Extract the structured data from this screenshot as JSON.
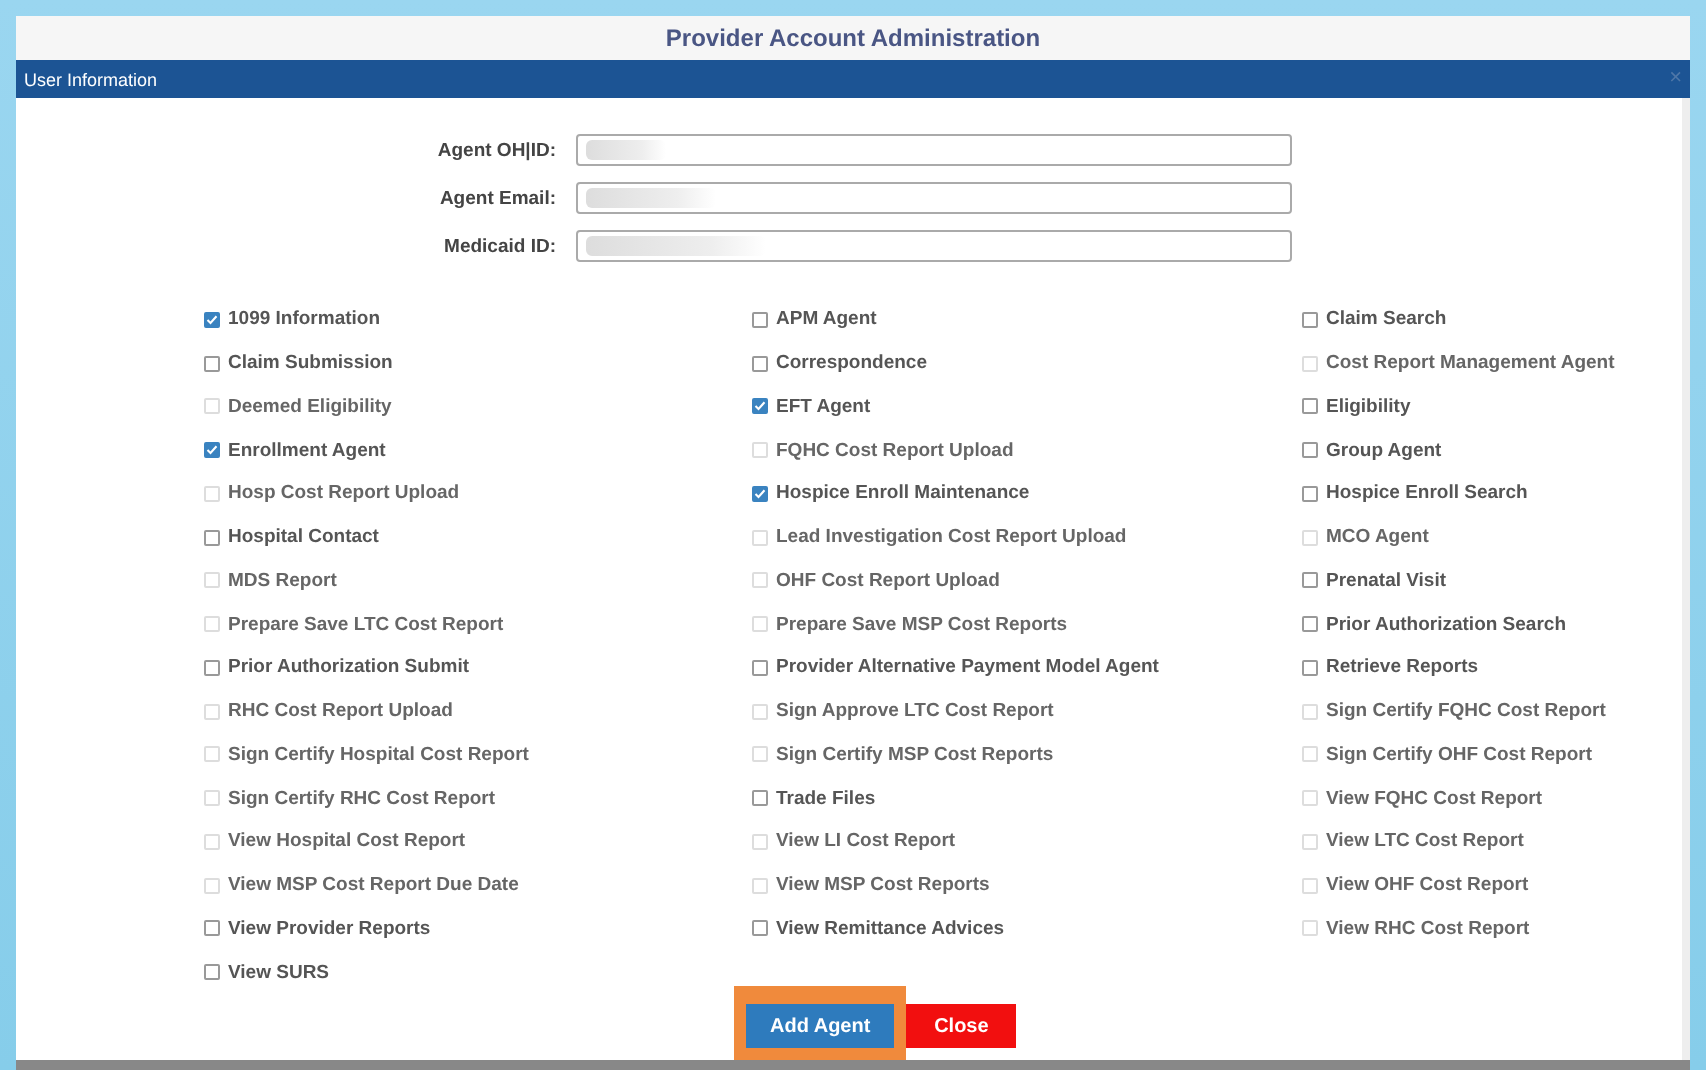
{
  "window": {
    "title": "Provider Account Administration"
  },
  "dialog": {
    "title": "User Information",
    "close": "×"
  },
  "fields": [
    {
      "label": "Agent OH|ID:"
    },
    {
      "label": "Agent Email:"
    },
    {
      "label": "Medicaid ID:"
    }
  ],
  "permission_columns": [
    [
      {
        "label": "1099 Information",
        "checked": true,
        "disabled": false
      },
      {
        "label": "Claim Submission",
        "checked": false,
        "disabled": false
      },
      {
        "label": "Deemed Eligibility",
        "checked": false,
        "disabled": true
      },
      {
        "label": "Enrollment Agent",
        "checked": true,
        "disabled": false
      },
      {
        "label": "Hosp Cost Report Upload",
        "checked": false,
        "disabled": true
      },
      {
        "label": "Hospital Contact",
        "checked": false,
        "disabled": false
      },
      {
        "label": "MDS Report",
        "checked": false,
        "disabled": true
      },
      {
        "label": "Prepare Save LTC Cost Report",
        "checked": false,
        "disabled": true
      },
      {
        "label": "Prior Authorization Submit",
        "checked": false,
        "disabled": false
      },
      {
        "label": "RHC Cost Report Upload",
        "checked": false,
        "disabled": true
      },
      {
        "label": "Sign Certify Hospital Cost Report",
        "checked": false,
        "disabled": true
      },
      {
        "label": "Sign Certify RHC Cost Report",
        "checked": false,
        "disabled": true
      },
      {
        "label": "View Hospital Cost Report",
        "checked": false,
        "disabled": true
      },
      {
        "label": "View MSP Cost Report Due Date",
        "checked": false,
        "disabled": true
      },
      {
        "label": "View Provider Reports",
        "checked": false,
        "disabled": false
      },
      {
        "label": "View SURS",
        "checked": false,
        "disabled": false
      }
    ],
    [
      {
        "label": "APM Agent",
        "checked": false,
        "disabled": false
      },
      {
        "label": "Correspondence",
        "checked": false,
        "disabled": false
      },
      {
        "label": "EFT Agent",
        "checked": true,
        "disabled": false
      },
      {
        "label": "FQHC Cost Report Upload",
        "checked": false,
        "disabled": true
      },
      {
        "label": "Hospice Enroll Maintenance",
        "checked": true,
        "disabled": false
      },
      {
        "label": "Lead Investigation Cost Report Upload",
        "checked": false,
        "disabled": true
      },
      {
        "label": "OHF Cost Report Upload",
        "checked": false,
        "disabled": true
      },
      {
        "label": "Prepare Save MSP Cost Reports",
        "checked": false,
        "disabled": true
      },
      {
        "label": "Provider Alternative Payment Model Agent",
        "checked": false,
        "disabled": false
      },
      {
        "label": "Sign Approve LTC Cost Report",
        "checked": false,
        "disabled": true
      },
      {
        "label": "Sign Certify MSP Cost Reports",
        "checked": false,
        "disabled": true
      },
      {
        "label": "Trade Files",
        "checked": false,
        "disabled": false
      },
      {
        "label": "View LI Cost Report",
        "checked": false,
        "disabled": true
      },
      {
        "label": "View MSP Cost Reports",
        "checked": false,
        "disabled": true
      },
      {
        "label": "View Remittance Advices",
        "checked": false,
        "disabled": false
      }
    ],
    [
      {
        "label": "Claim Search",
        "checked": false,
        "disabled": false
      },
      {
        "label": "Cost Report Management Agent",
        "checked": false,
        "disabled": true
      },
      {
        "label": "Eligibility",
        "checked": false,
        "disabled": false
      },
      {
        "label": "Group Agent",
        "checked": false,
        "disabled": false
      },
      {
        "label": "Hospice Enroll Search",
        "checked": false,
        "disabled": false
      },
      {
        "label": "MCO Agent",
        "checked": false,
        "disabled": true
      },
      {
        "label": "Prenatal Visit",
        "checked": false,
        "disabled": false
      },
      {
        "label": "Prior Authorization Search",
        "checked": false,
        "disabled": false
      },
      {
        "label": "Retrieve Reports",
        "checked": false,
        "disabled": false
      },
      {
        "label": "Sign Certify FQHC Cost Report",
        "checked": false,
        "disabled": true
      },
      {
        "label": "Sign Certify OHF Cost Report",
        "checked": false,
        "disabled": true
      },
      {
        "label": "View FQHC Cost Report",
        "checked": false,
        "disabled": true
      },
      {
        "label": "View LTC Cost Report",
        "checked": false,
        "disabled": true
      },
      {
        "label": "View OHF Cost Report",
        "checked": false,
        "disabled": true
      },
      {
        "label": "View RHC Cost Report",
        "checked": false,
        "disabled": true
      }
    ]
  ],
  "buttons": [
    {
      "label": "Add Agent",
      "kind": "primary",
      "focused": true
    },
    {
      "label": "Close",
      "kind": "danger",
      "focused": false
    }
  ]
}
